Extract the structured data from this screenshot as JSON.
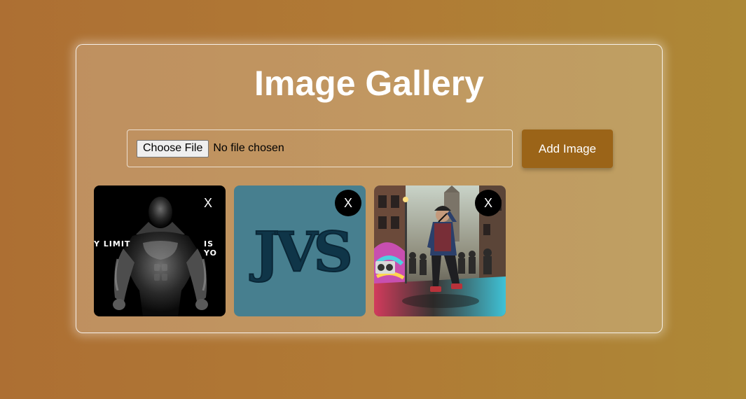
{
  "page": {
    "title": "Image Gallery"
  },
  "uploader": {
    "choose_label": "Choose File",
    "status": "No file chosen",
    "add_label": "Add Image"
  },
  "gallery": {
    "remove_label": "X",
    "items": [
      {
        "subject": "bodybuilder silhouette motivational image",
        "overlay_left": "Y LIMIT",
        "overlay_right": "IS YO"
      },
      {
        "subject": "JVS logo on teal background",
        "logo_text": "JVS"
      },
      {
        "subject": "street rapper with microphone in graffiti alley"
      }
    ]
  },
  "colors": {
    "accent_button": "#9b6418",
    "background_left": "#ad6f33",
    "background_right": "#ad8836",
    "logo_background": "#477f8f",
    "logo_text": "#123e55"
  }
}
